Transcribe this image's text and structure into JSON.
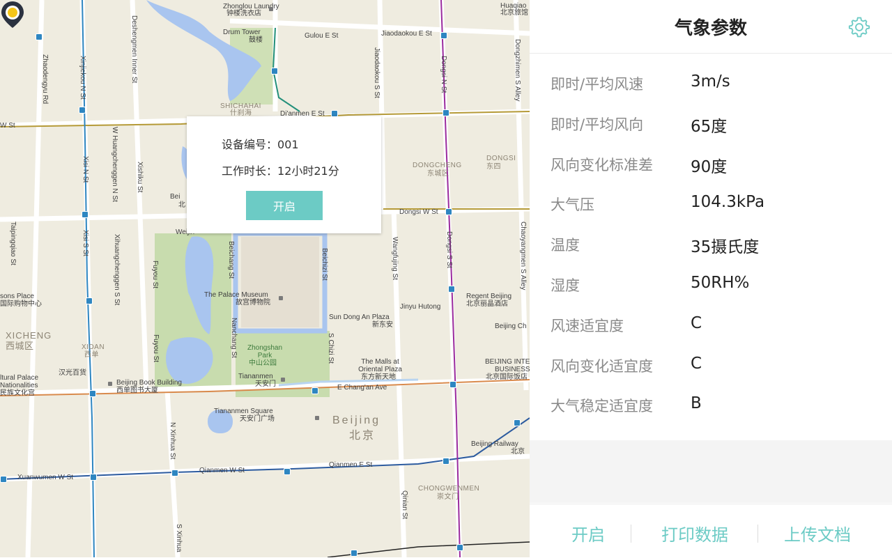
{
  "map": {
    "labels": {
      "zhonglou": "Zhonglou Laundry",
      "zhonglou_cn": "钟楼洗衣店",
      "huaqiao": "Huaqiao",
      "huaqiao_cn": "北京旅馆",
      "drum_tower": "Drum Tower",
      "drum_tower_cn": "鼓楼",
      "gulou_e": "Gulou E St",
      "jiaodaokou_e": "Jiaodaokou E St",
      "shichahai": "SHICHAHAI",
      "shichahai_cn": "什刹海",
      "dianmen": "Di'anmen E St",
      "dongcheng": "DONGCHENG",
      "dongcheng_cn": "东城区",
      "dongsi": "DONGSI",
      "dongsi_cn": "东四",
      "dongsi_w": "Dongsi W St",
      "weijin": "Weijin",
      "palace": "The Palace Museum",
      "palace_cn": "故宫博物院",
      "sunshine": "Sun Dong An Plaza",
      "sunshine_cn": "新东安",
      "jinyu": "Jinyu Hutong",
      "regent": "Regent Beijing",
      "regent_cn": "北京丽晶酒店",
      "zhongshan": "Zhongshan Park",
      "zhongshan_cn": "中山公园",
      "tiananmen": "Tiananmen",
      "tiananmen_cn": "天安门",
      "malls": "The Malls at Oriental Plaza",
      "malls_cn": "东方新天地",
      "changan": "E Chang'an Ave",
      "xicheng": "XICHENG",
      "xicheng_cn": "西城区",
      "xidan": "XIDAN",
      "xidan_cn": "西单",
      "hanguang": "汉光百货",
      "book": "Beijing Book Building",
      "book_cn": "西单图书大厦",
      "cultural": "ltural Palace",
      "nationalities": "Nationalities",
      "nationalities_cn": "民族文化宫",
      "seasons": "sons Place",
      "seasons_cn": "国际购物中心",
      "square": "Tiananmen Square",
      "square_cn": "天安门广场",
      "beijing": "Beijing",
      "beijing_cn": "北京",
      "railway": "Beijing Railway",
      "railway_cn": "北京",
      "qianmen_e": "Qianmen E St",
      "qianmen_w": "Qianmen W St",
      "xuanwumen": "Xuanwumen W St",
      "chongwenmen": "CHONGWENMEN",
      "chongwenmen_cn": "崇文门",
      "beijing_int": "BEIJING INTE",
      "business": "BUSINESS",
      "business_cn": "北京国际饭店",
      "beijing_ch": "Beijing Ch",
      "bei_cn": "Bei",
      "bei_cn2": "北",
      "w_st": "W St",
      "zhaodengyu": "Zhaodengyu Rd",
      "xinjiekou": "Xinjiekou N St",
      "deshengmen": "Deshengmen Inner St",
      "jiaodaokou_s": "Jiaodaokou S St",
      "dongsi_n": "Dongsi N St",
      "dongzhimen": "Dongzhimen S Alley",
      "xinjiekou_s": "Xinjiekou S St",
      "xisi_n": "Xisi N St",
      "huangchenggen_n": "W Huangchenggen N St",
      "xishiku": "Xishiku St",
      "taipingqiao": "Taipingqiao St",
      "xisi_s": "Xisi S St",
      "xihuangchenggen_s": "Xihuangchenggen S St",
      "fuyou": "Fuyou St",
      "beichang": "Beichang St",
      "nanchang": "Nanchang St",
      "beichizi": "Beichizi St",
      "nanchizi": "S Chizi St",
      "wangfujing": "Wangfujing St",
      "dongsi_s": "Dongsi S St",
      "chaoyangmen": "Chaoyangmen S Alley",
      "n_xinhua": "N Xinhua St",
      "s_xinhua": "S Xinhua",
      "qinian": "Qinian St"
    },
    "popup": {
      "device_label": "设备编号：",
      "device_value": "001",
      "duration_label": "工作时长：",
      "duration_value": "12小时21分",
      "button_label": "开启"
    },
    "marker_icon": "location-pin-icon"
  },
  "panel": {
    "title": "气象参数",
    "settings_icon": "gear-icon",
    "params": [
      {
        "label": "即时/平均风速",
        "value": "3m/s"
      },
      {
        "label": "即时/平均风向",
        "value": "65度"
      },
      {
        "label": "风向变化标准差",
        "value": "90度"
      },
      {
        "label": "大气压",
        "value": "104.3kPa"
      },
      {
        "label": "温度",
        "value": "35摄氏度"
      },
      {
        "label": "湿度",
        "value": "50RH%"
      },
      {
        "label": "风速适宜度",
        "value": "C"
      },
      {
        "label": "风向变化适宜度",
        "value": "C"
      },
      {
        "label": "大气稳定适宜度",
        "value": "B"
      }
    ],
    "footer": {
      "open": "开启",
      "print": "打印数据",
      "upload": "上传文档"
    },
    "accent_color": "#6ccbc5"
  }
}
